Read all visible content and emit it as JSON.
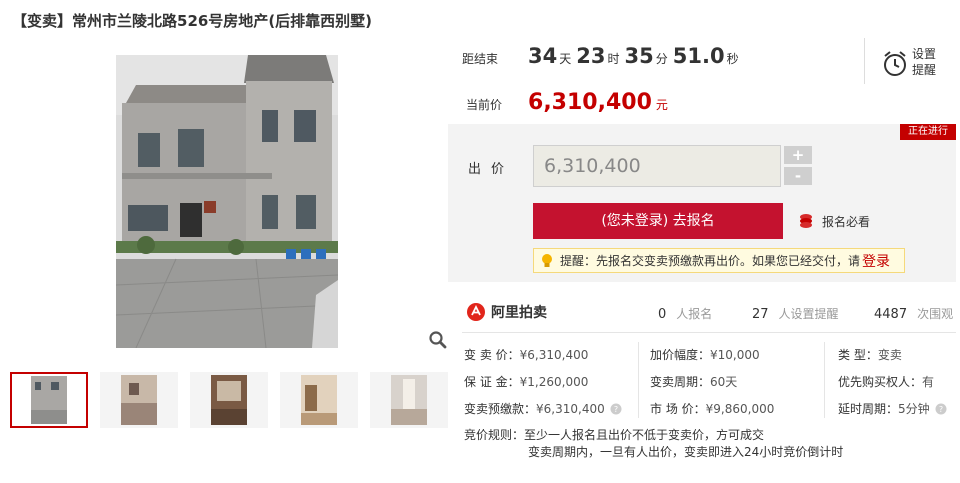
{
  "title": "【变卖】常州市兰陵北路526号房地产(后排靠西别墅)",
  "countdown": {
    "label": "距结束",
    "days": "34",
    "days_unit": "天",
    "hours": "23",
    "hours_unit": "时",
    "minutes": "35",
    "minutes_unit": "分",
    "seconds": "51.0",
    "seconds_unit": "秒"
  },
  "remind": {
    "line1": "设置",
    "line2": "提醒",
    "icon": "alarm-clock-icon"
  },
  "current_price": {
    "label": "当前价",
    "value": "6,310,400",
    "unit": "元"
  },
  "status_badge": "正在进行",
  "bid": {
    "label": "出价",
    "value": "6,310,400",
    "plus": "+",
    "minus": "-",
    "signup_button": "(您未登录) 去报名",
    "must_read": "报名必看",
    "reminder_prefix": "提醒：先报名交变卖预缴款再出价。如果您已经交付，请",
    "login_link": "登录"
  },
  "platform": {
    "name": "阿里拍卖",
    "signups": "0",
    "signups_label": "人报名",
    "reminders": "27",
    "reminders_label": "人设置提醒",
    "views": "4487",
    "views_label": "次围观"
  },
  "info": {
    "col1": [
      {
        "label": "变 卖 价：",
        "value": "¥6,310,400"
      },
      {
        "label": "保 证 金：",
        "value": "¥1,260,000"
      },
      {
        "label": "变卖预缴款：",
        "value": "¥6,310,400"
      }
    ],
    "col2": [
      {
        "label": "加价幅度：",
        "value": "¥10,000"
      },
      {
        "label": "变卖周期：",
        "value": "60天"
      },
      {
        "label": "市 场 价：",
        "value": "¥9,860,000"
      }
    ],
    "col3": [
      {
        "label": "类    型：",
        "value": "变卖"
      },
      {
        "label": "优先购买权人：",
        "value": "有"
      },
      {
        "label": "延时周期：",
        "value": "5分钟"
      }
    ]
  },
  "rules": {
    "label": "竞价规则：",
    "line1": "至少一人报名且出价不低于变卖价，方可成交",
    "line2": "变卖周期内，一旦有人出价，变卖即进入24小时竞价倒计时"
  },
  "colors": {
    "accent": "#c40000",
    "button": "#c4122f",
    "panel": "#f3f3f3"
  }
}
